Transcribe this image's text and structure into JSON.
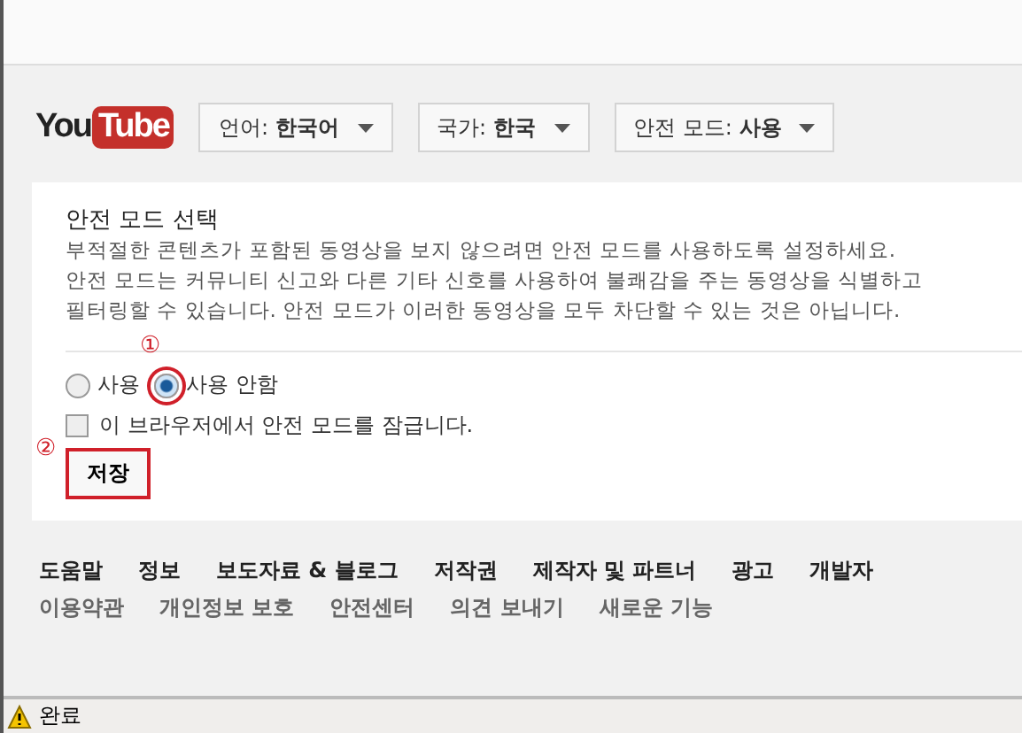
{
  "header": {
    "logo": {
      "you": "You",
      "tube": "Tube"
    },
    "dropdowns": [
      {
        "label": "언어:",
        "value": "한국어"
      },
      {
        "label": "국가:",
        "value": "한국"
      },
      {
        "label": "안전 모드:",
        "value": "사용"
      }
    ]
  },
  "panel": {
    "title": "안전 모드 선택",
    "description": [
      "부적절한 콘텐츠가 포함된 동영상을 보지 않으려면 안전 모드를 사용하도록 설정하세요.",
      "안전 모드는 커뮤니티 신고와 다른 기타 신호를 사용하여 불쾌감을 주는 동영상을 식별하고",
      "필터링할 수 있습니다. 안전 모드가 이러한 동영상을 모두 차단할 수 있는 것은 아닙니다."
    ],
    "radios": [
      {
        "label": "사용",
        "selected": false,
        "highlighted": false
      },
      {
        "label": "사용 안함",
        "selected": true,
        "highlighted": true,
        "annotation": "①"
      }
    ],
    "lock": {
      "label": "이 브라우저에서 안전 모드를 잠급니다.",
      "checked": false
    },
    "save": {
      "label": "저장",
      "highlighted": true,
      "annotation": "②"
    }
  },
  "footer": {
    "primary_links": [
      "도움말",
      "정보",
      "보도자료 & 블로그",
      "저작권",
      "제작자 및 파트너",
      "광고",
      "개발자"
    ],
    "secondary_links": [
      "이용약관",
      "개인정보 보호",
      "안전센터",
      "의견 보내기",
      "새로운 기능"
    ]
  },
  "status_bar": {
    "text": "완료"
  }
}
